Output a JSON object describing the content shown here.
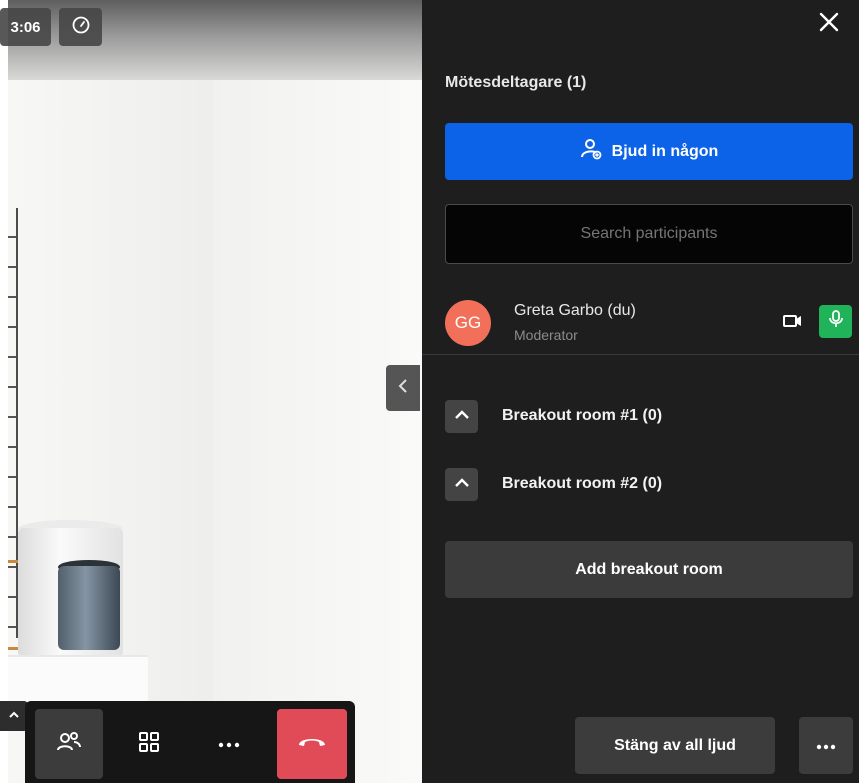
{
  "video": {
    "timer": "3:06",
    "speed_icon": "gauge-icon"
  },
  "toolbar": {
    "participants_icon": "participants-icon",
    "grid_icon": "tile-view-icon",
    "more_icon": "more-horizontal-icon",
    "hangup_icon": "hangup-icon",
    "hangup_color": "#e04b57"
  },
  "panel": {
    "title": "Mötesdeltagare (1)",
    "invite_label": "Bjud in någon",
    "search_placeholder": "Search participants",
    "participants": [
      {
        "initials": "GG",
        "name": "Greta Garbo (du)",
        "role": "Moderator",
        "avatar_color": "#f2705a"
      }
    ],
    "breakout_rooms": [
      {
        "label": "Breakout room #1 (0)"
      },
      {
        "label": "Breakout room #2 (0)"
      }
    ],
    "add_breakout_label": "Add breakout room",
    "mute_all_label": "Stäng av all ljud"
  },
  "colors": {
    "accent": "#0c63e7",
    "mic_active": "#20b35a",
    "panel_bg": "#1e1e1e"
  }
}
